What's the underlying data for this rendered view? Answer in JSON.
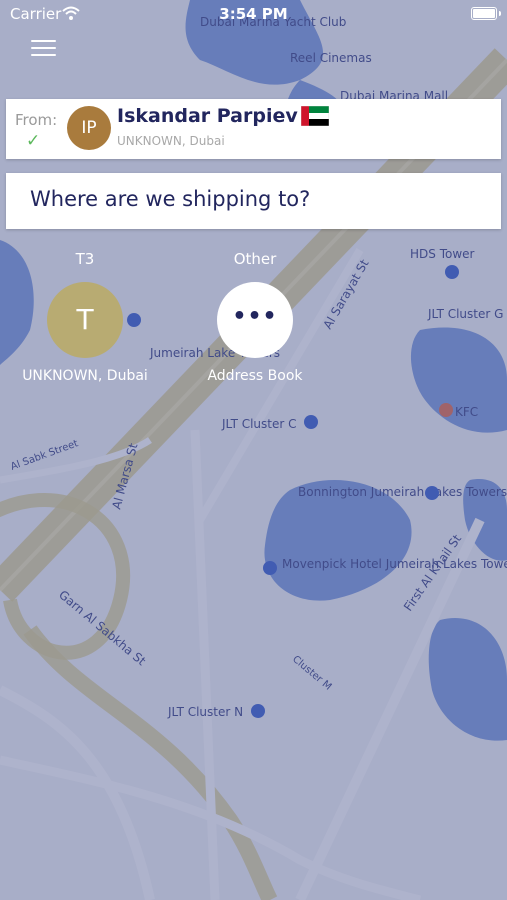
{
  "status_bar": {
    "carrier": "Carrier",
    "time": "3:54 PM"
  },
  "map": {
    "labels": [
      {
        "text": "Dubai Marina Yacht Club"
      },
      {
        "text": "Reel Cinemas"
      },
      {
        "text": "Dubai Marina Mall"
      },
      {
        "text": "HDS Tower"
      },
      {
        "text": "JLT Cluster G"
      },
      {
        "text": "Jumeirah Lake Towers"
      },
      {
        "text": "Al Sarayat St"
      },
      {
        "text": "KFC"
      },
      {
        "text": "JLT Cluster C"
      },
      {
        "text": "Al Sabk Street"
      },
      {
        "text": "Al Marsa St"
      },
      {
        "text": "Bonnington Jumeirah Lakes Towers"
      },
      {
        "text": "Movenpick Hotel Jumeirah Lakes Towers"
      },
      {
        "text": "Garn Al Sabkha St"
      },
      {
        "text": "First Al Khail St"
      },
      {
        "text": "JLT Cluster N"
      },
      {
        "text": "Cluster M"
      }
    ]
  },
  "sender": {
    "from_label": "From:",
    "initials": "IP",
    "name": "Iskandar Parpiev",
    "location": "UNKNOWN, Dubai",
    "flag": "uae-flag"
  },
  "destination": {
    "placeholder": "Where are we shipping to?"
  },
  "quick_picks": [
    {
      "label": "T3",
      "initial": "T",
      "subtitle": "UNKNOWN, Dubai",
      "color": "#b8ab72"
    },
    {
      "label": "Other",
      "initial": "•••",
      "subtitle": "Address Book",
      "color": "#ffffff"
    }
  ],
  "colors": {
    "overlay": "#5c6496",
    "text_dark": "#22265e",
    "check": "#5cb85c",
    "avatar": "#a97b3d"
  }
}
